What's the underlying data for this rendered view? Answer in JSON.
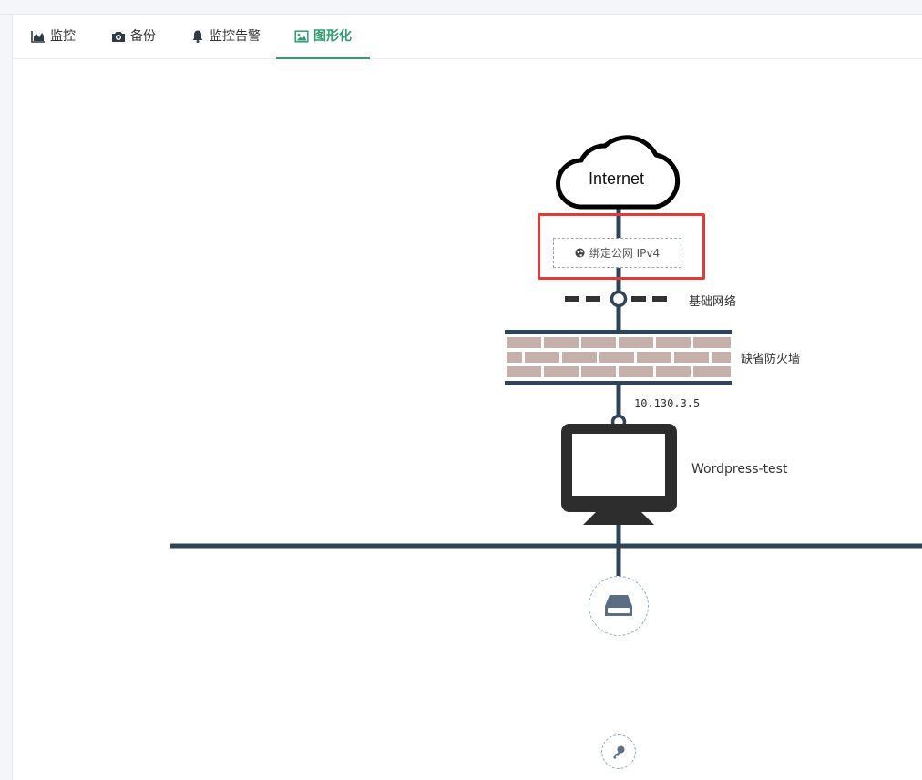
{
  "tabs": [
    {
      "label": "监控",
      "icon": "area-chart-icon",
      "active": false
    },
    {
      "label": "备份",
      "icon": "camera-icon",
      "active": false
    },
    {
      "label": "监控告警",
      "icon": "bell-icon",
      "active": false
    },
    {
      "label": "图形化",
      "icon": "image-icon",
      "active": true
    }
  ],
  "topology": {
    "internet_label": "Internet",
    "bind_eip_label": "绑定公网 IPv4",
    "network_label": "基础网络",
    "firewall_label": "缺省防火墙",
    "ip_address": "10.130.3.5",
    "instance_name": "Wordpress-test",
    "disk_icon": "hard-drive-icon",
    "key_icon": "key-icon"
  },
  "colors": {
    "accent": "#2e9e6f",
    "line": "#2f4456",
    "brick": "#c5b0ab",
    "highlight": "#e53935",
    "monitor": "#2d2d2d"
  }
}
